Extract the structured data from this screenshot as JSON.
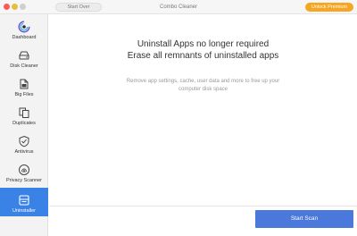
{
  "titlebar": {
    "title": "Combo Cleaner",
    "start_over_label": "Start Over",
    "unlock_label": "Unlock Premium"
  },
  "sidebar": {
    "items": [
      {
        "label": "Dashboard",
        "icon": "combo-cleaner-logo-icon"
      },
      {
        "label": "Disk Cleaner",
        "icon": "disk-drive-icon"
      },
      {
        "label": "Big Files",
        "icon": "big-files-icon"
      },
      {
        "label": "Duplicates",
        "icon": "duplicate-files-icon"
      },
      {
        "label": "Antivirus",
        "icon": "shield-icon"
      },
      {
        "label": "Privacy Scanner",
        "icon": "fingerprint-icon"
      },
      {
        "label": "Uninstaller",
        "icon": "uninstaller-box-icon",
        "active": true
      }
    ]
  },
  "main": {
    "headline_line1": "Uninstall Apps no longer required",
    "headline_line2": "Erase all remnants of uninstalled apps",
    "subtext_line1": "Remove app settings, cache, user data and more to free up your",
    "subtext_line2": "computer disk space"
  },
  "footer": {
    "start_scan_label": "Start Scan"
  },
  "colors": {
    "accent": "#3b82e6",
    "button": "#4a78db",
    "premium": "#f5a623"
  }
}
